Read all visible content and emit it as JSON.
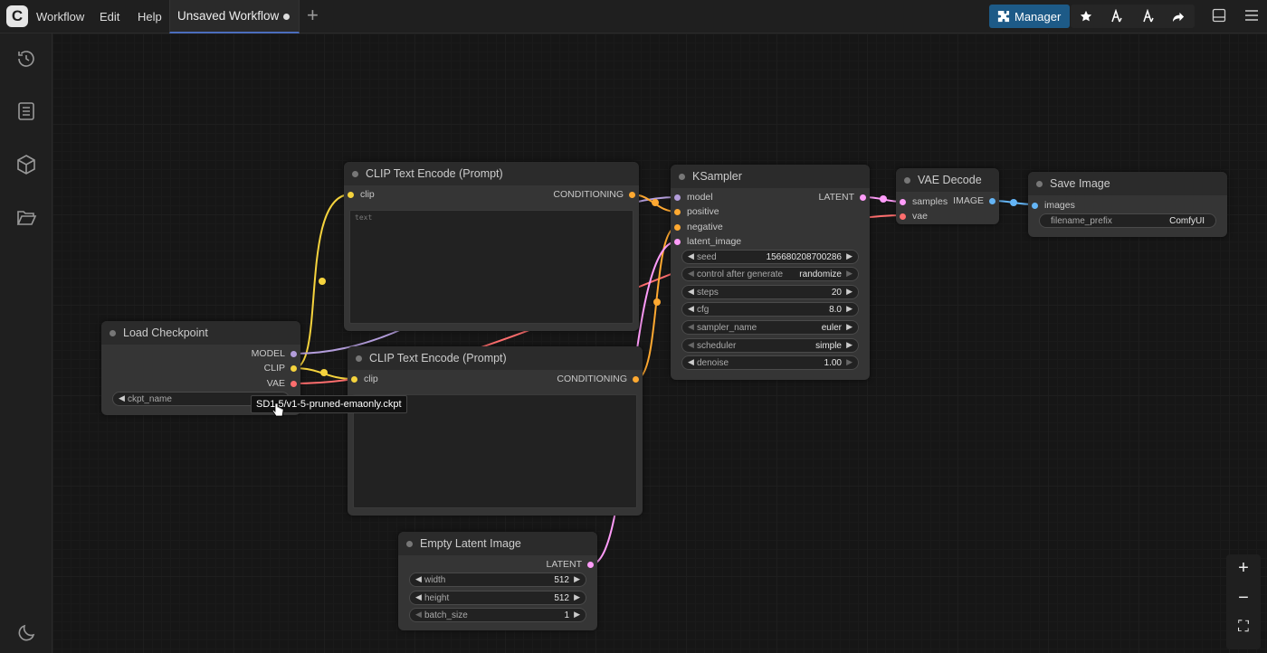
{
  "menu": [
    "Workflow",
    "Edit",
    "Help"
  ],
  "tab": {
    "title": "Unsaved Workflow"
  },
  "toolbar": {
    "manager_label": "Manager"
  },
  "tooltip": "SD1.5/v1-5-pruned-emaonly.ckpt",
  "nodes": {
    "clip_top": {
      "title": "CLIP Text Encode (Prompt)",
      "input": "clip",
      "output": "CONDITIONING",
      "placeholder": "text"
    },
    "clip_bottom": {
      "title": "CLIP Text Encode (Prompt)",
      "input": "clip",
      "output": "CONDITIONING"
    },
    "checkpoint": {
      "title": "Load Checkpoint",
      "outputs": [
        "MODEL",
        "CLIP",
        "VAE"
      ],
      "widget_label": "ckpt_name"
    },
    "ksampler": {
      "title": "KSampler",
      "inputs": [
        "model",
        "positive",
        "negative",
        "latent_image"
      ],
      "output": "LATENT",
      "widgets": [
        {
          "label": "seed",
          "value": "156680208700286"
        },
        {
          "label": "control after generate",
          "value": "randomize"
        },
        {
          "label": "steps",
          "value": "20"
        },
        {
          "label": "cfg",
          "value": "8.0"
        },
        {
          "label": "sampler_name",
          "value": "euler"
        },
        {
          "label": "scheduler",
          "value": "simple"
        },
        {
          "label": "denoise",
          "value": "1.00"
        }
      ]
    },
    "vae_decode": {
      "title": "VAE Decode",
      "inputs": [
        "samples",
        "vae"
      ],
      "output": "IMAGE"
    },
    "save_image": {
      "title": "Save Image",
      "input": "images",
      "widget": {
        "label": "filename_prefix",
        "value": "ComfyUI"
      }
    },
    "empty_latent": {
      "title": "Empty Latent Image",
      "output": "LATENT",
      "widgets": [
        {
          "label": "width",
          "value": "512"
        },
        {
          "label": "height",
          "value": "512"
        },
        {
          "label": "batch_size",
          "value": "1"
        }
      ]
    }
  },
  "colors": {
    "clip": "#f5d33d",
    "model": "#b39ddb",
    "vae": "#ff6e6e",
    "conditioning": "#ffa931",
    "latent": "#ff9cf9",
    "image": "#64b5f6"
  }
}
